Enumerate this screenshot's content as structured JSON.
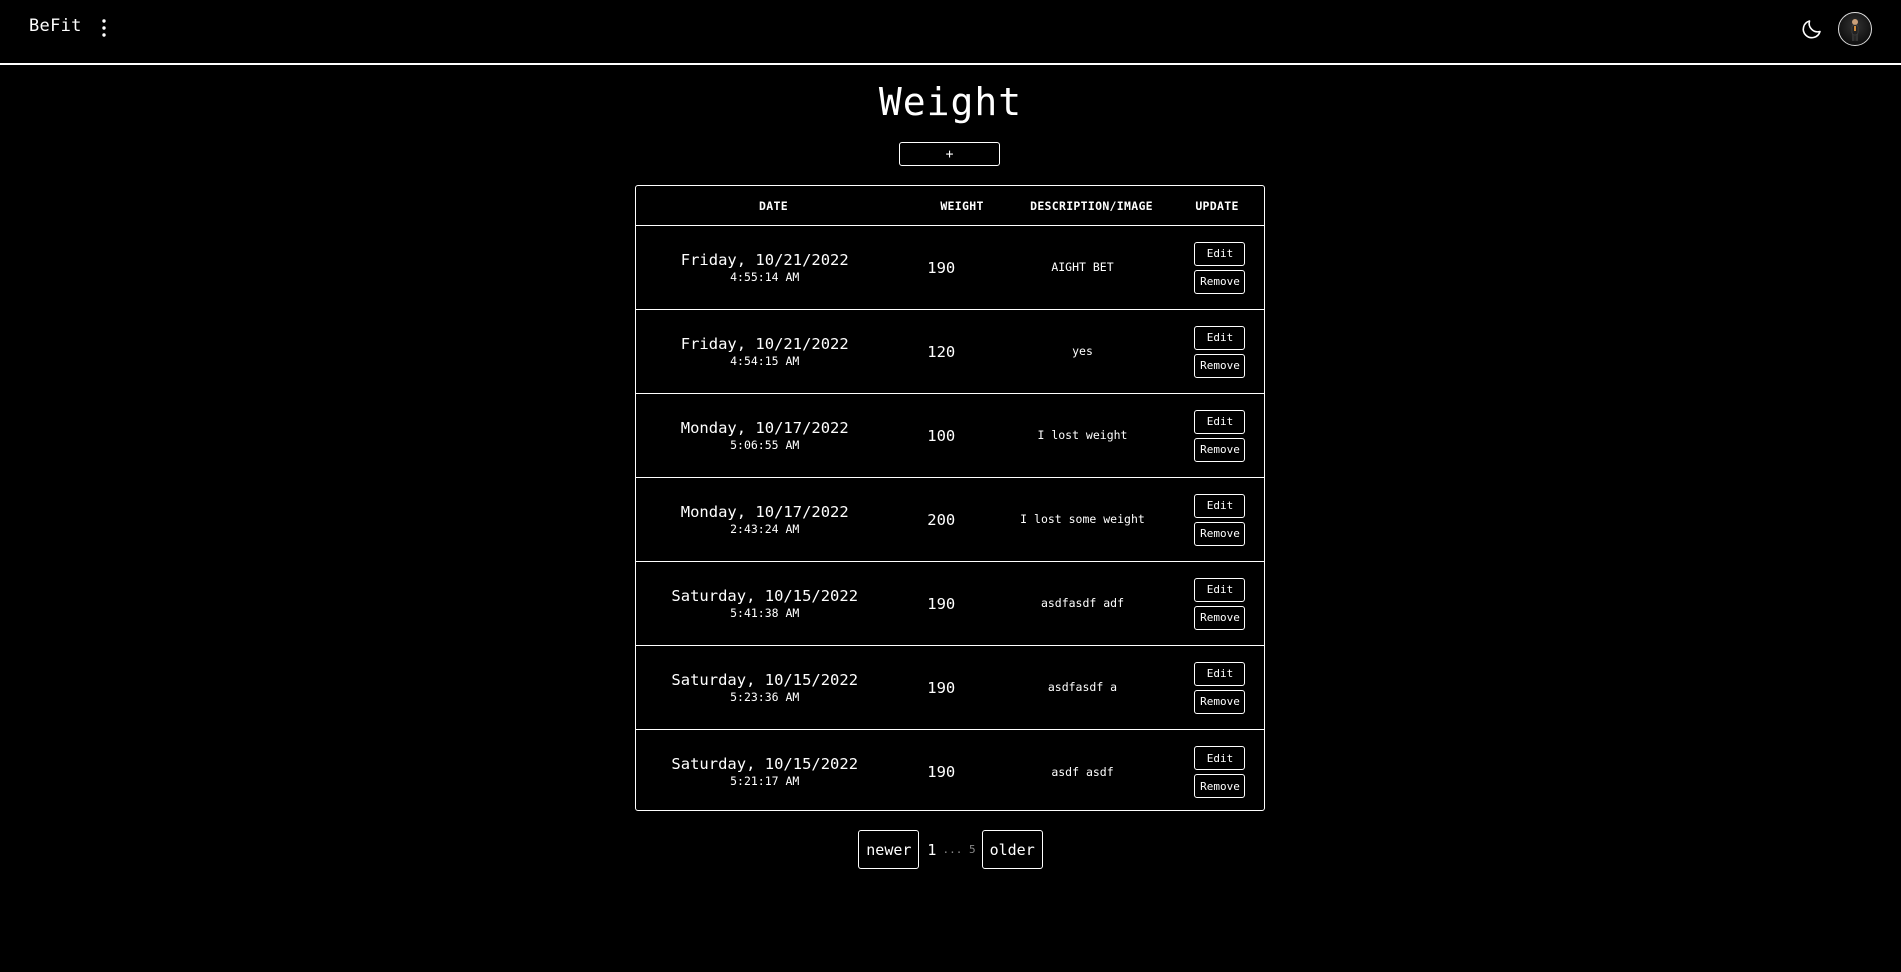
{
  "header": {
    "brand": "BeFit",
    "menu_icon": "kebab-menu-icon",
    "theme_icon": "moon-icon",
    "avatar_icon": "user-avatar"
  },
  "page": {
    "title": "Weight",
    "add_label": "+"
  },
  "table": {
    "columns": [
      "DATE",
      "WEIGHT",
      "DESCRIPTION/IMAGE",
      "UPDATE"
    ],
    "edit_label": "Edit",
    "remove_label": "Remove",
    "rows": [
      {
        "date": "Friday, 10/21/2022",
        "time": "4:55:14 AM",
        "weight": "190",
        "description": "AIGHT BET"
      },
      {
        "date": "Friday, 10/21/2022",
        "time": "4:54:15 AM",
        "weight": "120",
        "description": "yes"
      },
      {
        "date": "Monday, 10/17/2022",
        "time": "5:06:55 AM",
        "weight": "100",
        "description": "I lost weight"
      },
      {
        "date": "Monday, 10/17/2022",
        "time": "2:43:24 AM",
        "weight": "200",
        "description": "I lost some weight"
      },
      {
        "date": "Saturday, 10/15/2022",
        "time": "5:41:38 AM",
        "weight": "190",
        "description": "asdfasdf adf"
      },
      {
        "date": "Saturday, 10/15/2022",
        "time": "5:23:36 AM",
        "weight": "190",
        "description": "asdfasdf a"
      },
      {
        "date": "Saturday, 10/15/2022",
        "time": "5:21:17 AM",
        "weight": "190",
        "description": "asdf asdf"
      }
    ]
  },
  "pagination": {
    "newer_label": "newer",
    "current_page": "1",
    "ellipsis": "...",
    "last_page": "5",
    "older_label": "older"
  }
}
